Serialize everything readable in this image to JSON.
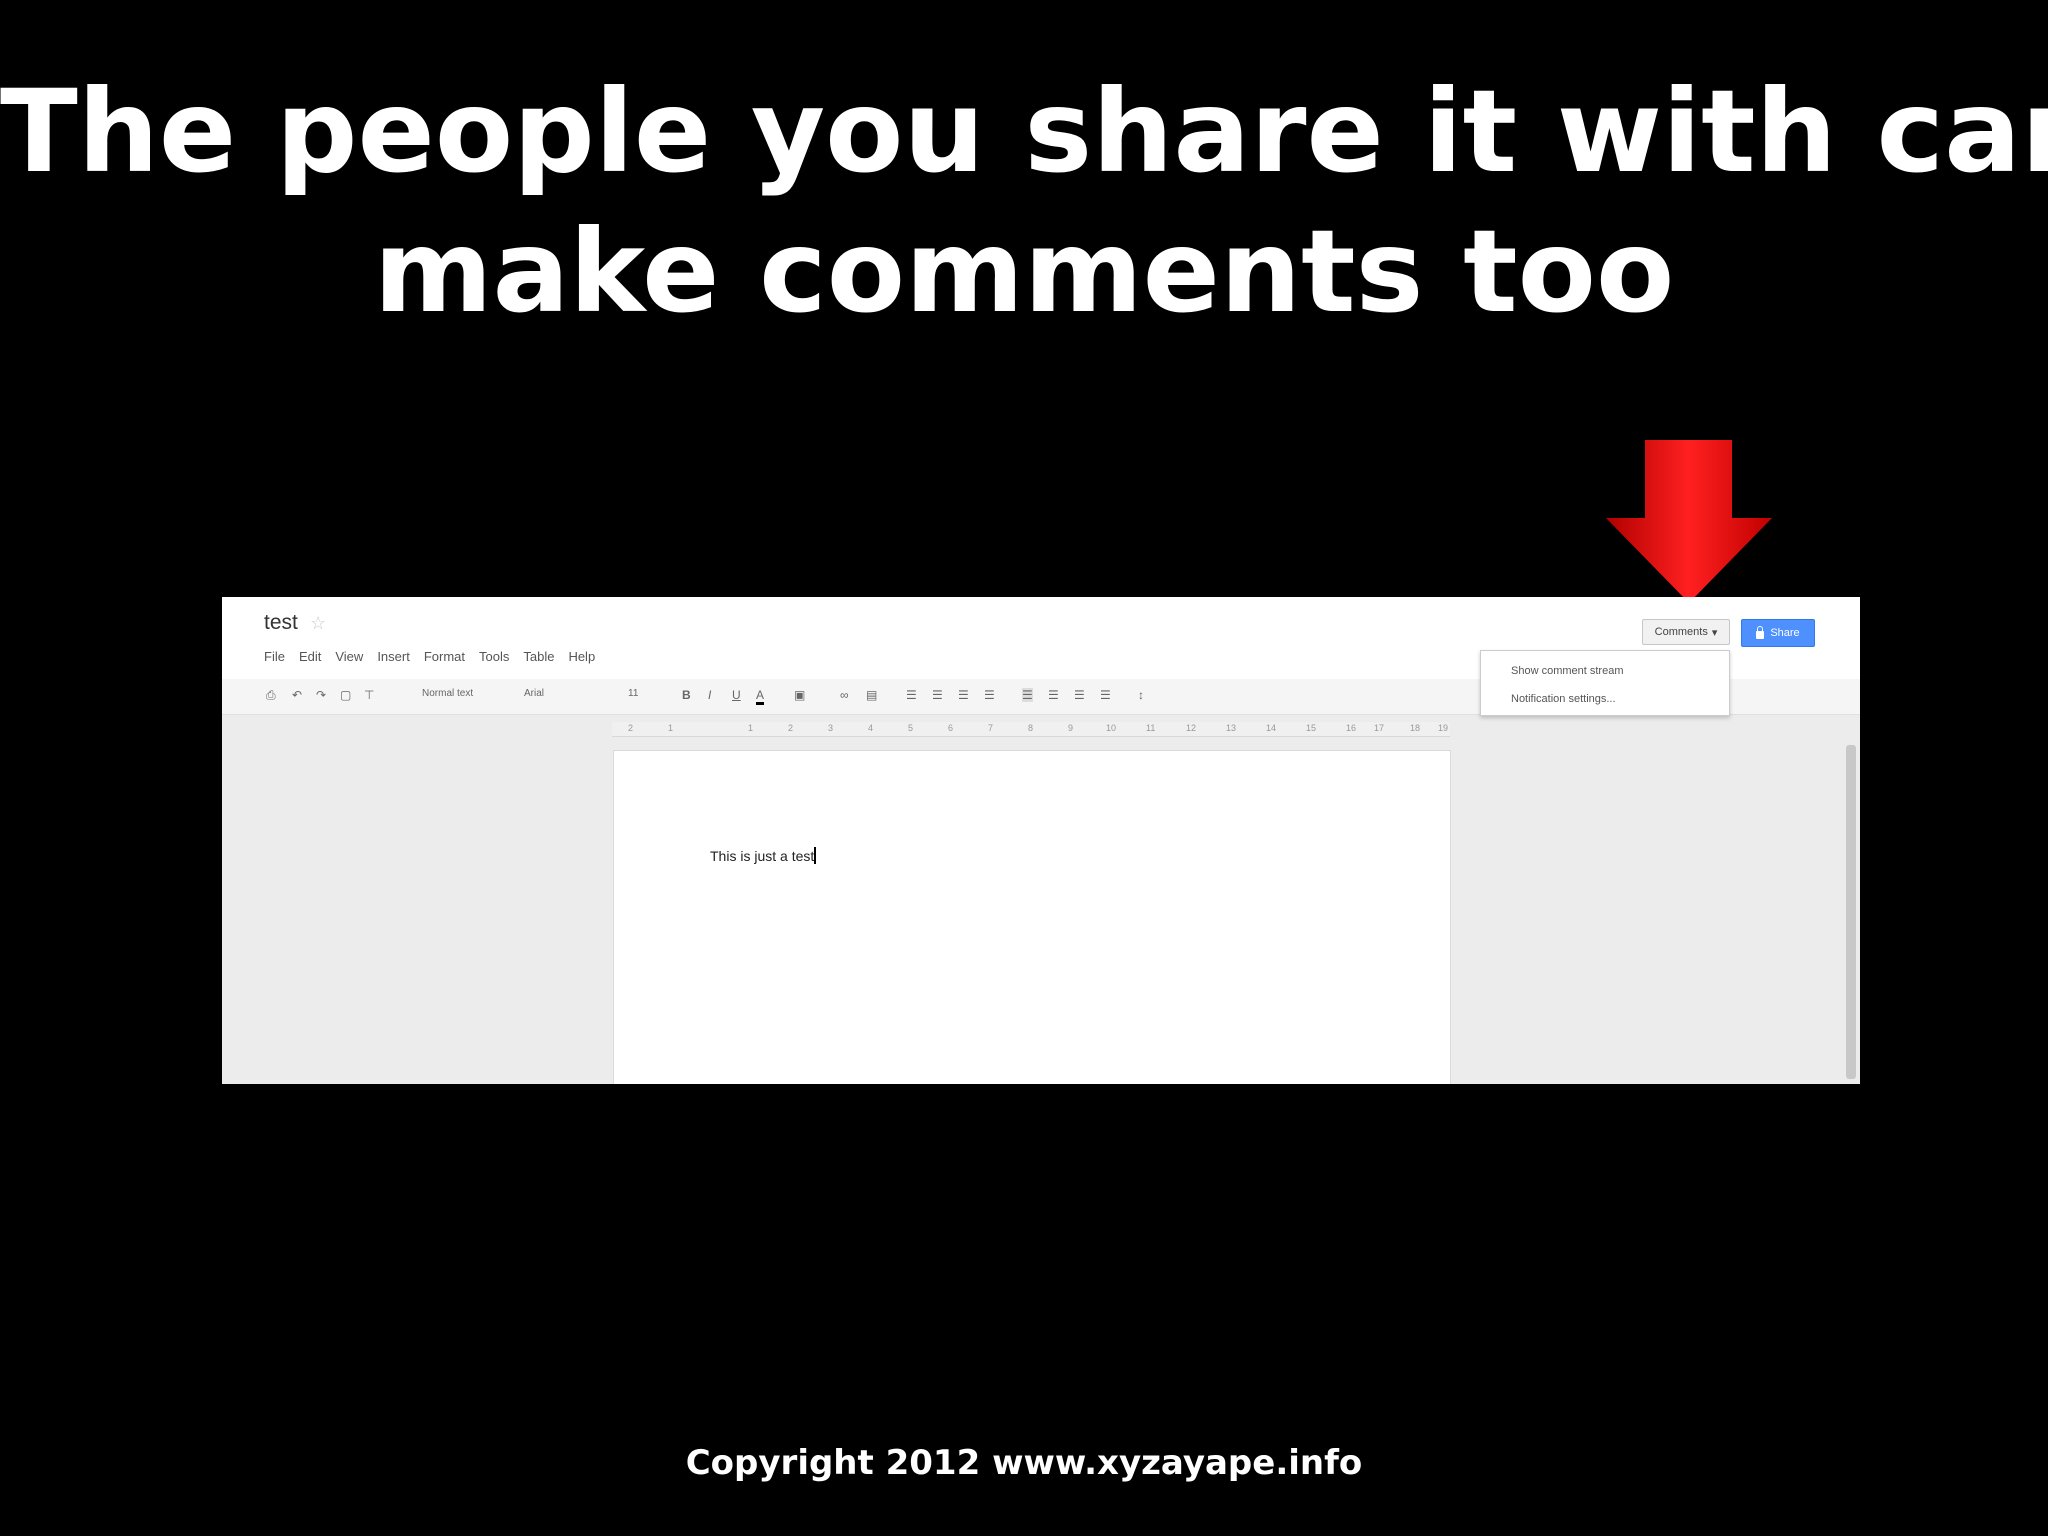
{
  "slide": {
    "title_line1": "The people you share it with can",
    "title_line2": "make comments too",
    "footer": "Copyright 2012 www.xyzayape.info",
    "arrow_color": "#ff0000"
  },
  "docs": {
    "doc_title": "test",
    "menu": [
      "File",
      "Edit",
      "View",
      "Insert",
      "Format",
      "Tools",
      "Table",
      "Help"
    ],
    "comments_label": "Comments",
    "share_label": "Share",
    "dropdown": [
      "Show comment stream",
      "Notification settings..."
    ],
    "toolbar": {
      "style": "Normal text",
      "font": "Arial",
      "size": "11",
      "bold": "B",
      "italic": "I",
      "underline": "U",
      "text_color": "A"
    },
    "ruler_ticks": [
      "2",
      "1",
      "1",
      "2",
      "3",
      "4",
      "5",
      "6",
      "7",
      "8",
      "9",
      "10",
      "11",
      "12",
      "13",
      "14",
      "15",
      "16",
      "17",
      "18",
      "19"
    ],
    "body_text": "This is just a test",
    "accent": "#4d90fe"
  }
}
